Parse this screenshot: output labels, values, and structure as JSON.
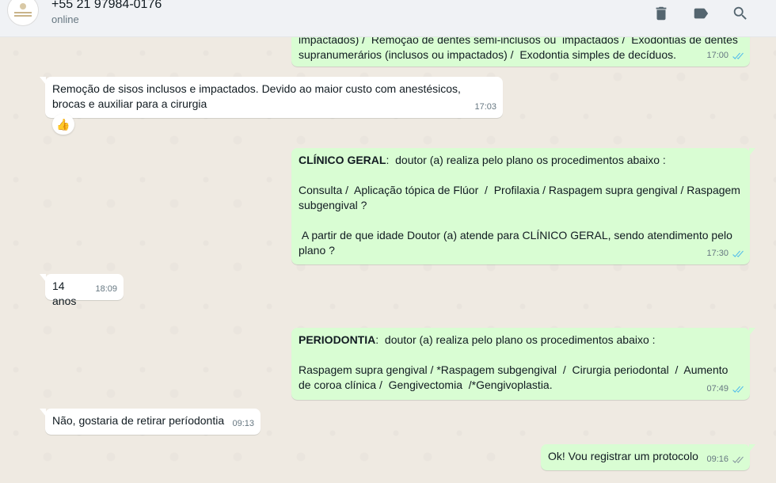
{
  "header": {
    "contact_name": "+55 21 97984-0176",
    "status": "online",
    "icons": [
      "delete-icon",
      "label-icon",
      "search-icon"
    ]
  },
  "colors": {
    "incoming_bubble": "#ffffff",
    "outgoing_bubble": "#d9fdd3",
    "read_ticks": "#53bdeb",
    "chat_background": "#efeae2"
  },
  "messages": [
    {
      "direction": "out",
      "text": "impactados) /  Remoção de dentes semi-inclusos ou  impactados /  Exodontias de dentes supranumerários (inclusos ou impactados) /  Exodontia simples de decíduos.",
      "time": "17:00",
      "status": "read"
    },
    {
      "direction": "in",
      "text": "Remoção de sisos inclusos e impactados. Devido ao maior custo com anestésicos, brocas e auxiliar para a cirurgia",
      "time": "17:03",
      "reaction": "👍"
    },
    {
      "direction": "out",
      "bold_prefix": "CLÍNICO GERAL",
      "text_after_bold": ":  doutor (a) realiza pelo plano os procedimentos abaixo :",
      "paragraph2": "Consulta /  Aplicação tópica de Flúor  /  Profilaxia / Raspagem supra gengival / Raspagem subgengival ?",
      "paragraph3": " A partir de que idade Doutor (a) atende para CLÍNICO GERAL, sendo atendimento pelo plano ?",
      "time": "17:30",
      "status": "read"
    },
    {
      "direction": "in",
      "text": "14 anos",
      "time": "18:09"
    },
    {
      "direction": "out",
      "bold_prefix": "PERIODONTIA",
      "text_after_bold": ":  doutor (a) realiza pelo plano os procedimentos abaixo :",
      "paragraph2": "Raspagem supra gengival / *Raspagem subgengival  /  Cirurgia periodontal  /  Aumento de coroa clínica /  Gengivectomia  /*Gengivoplastia.",
      "time": "07:49",
      "status": "read"
    },
    {
      "direction": "in",
      "text": "Não, gostaria de retirar períodontia",
      "time": "09:13"
    },
    {
      "direction": "out",
      "text": "Ok! Vou registrar um protocolo",
      "time": "09:16",
      "status": "delivered"
    }
  ]
}
